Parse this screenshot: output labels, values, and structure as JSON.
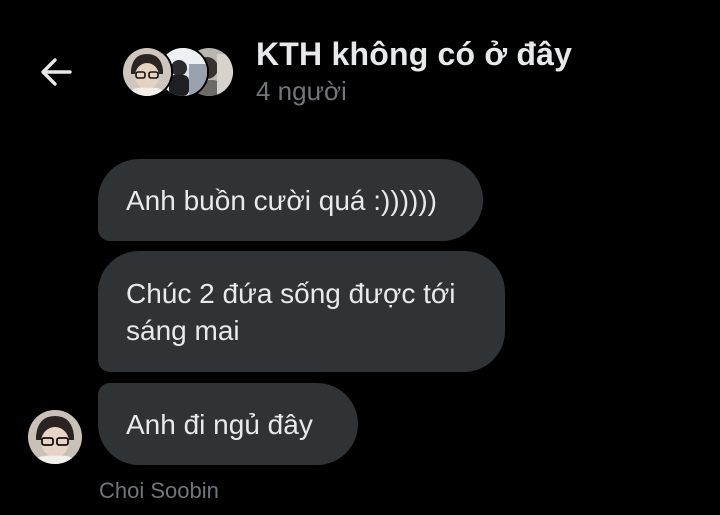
{
  "header": {
    "back_icon": "arrow-left-icon",
    "title": "KTH không có ở đây",
    "member_count": "4 người",
    "avatars": [
      "group-member-avatar-1",
      "group-member-avatar-2",
      "group-member-avatar-3"
    ]
  },
  "messages": [
    {
      "text": "Anh buồn cười quá :))))))"
    },
    {
      "text": "Chúc 2 đứa sống được tới sáng mai"
    },
    {
      "text": "Anh đi ngủ đây"
    }
  ],
  "sender": {
    "name": "Choi Soobin",
    "avatar": "sender-avatar"
  },
  "colors": {
    "background": "#000000",
    "bubble": "#2f3336",
    "primary_text": "#e7e9ea",
    "secondary_text": "#71767b"
  }
}
